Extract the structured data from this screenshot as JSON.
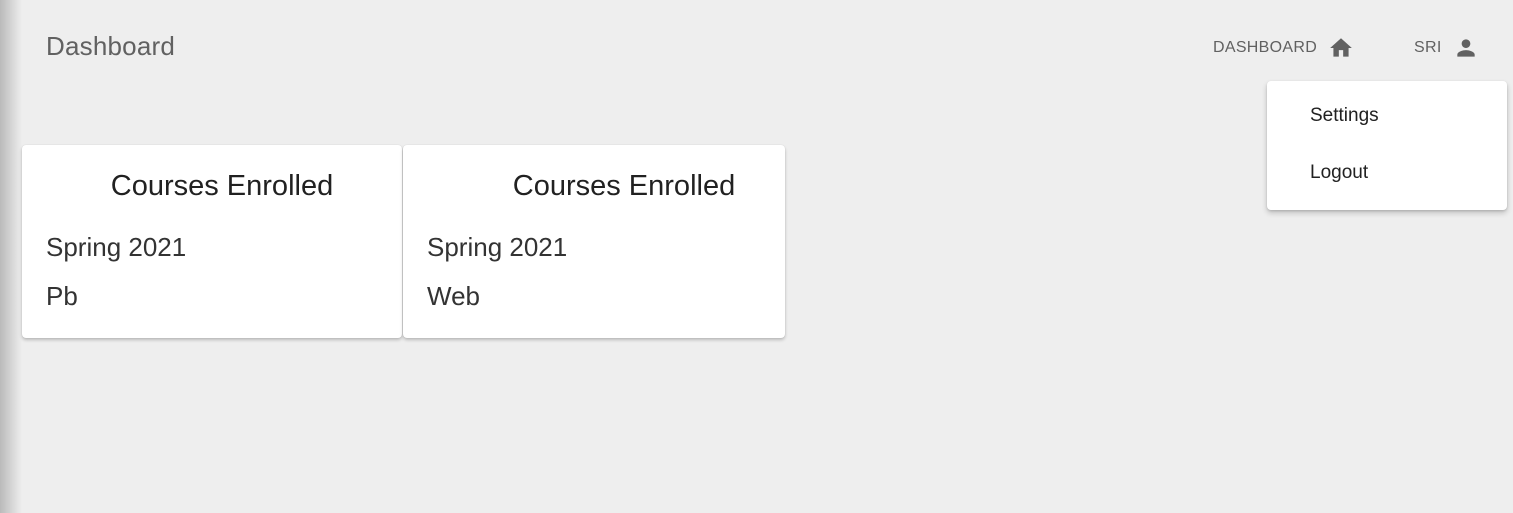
{
  "app": {
    "title": "Dashboard"
  },
  "nav": {
    "dashboard_label": "DASHBOARD",
    "dashboard_icon": "home-icon",
    "user_label": "SRI",
    "user_icon": "person-icon"
  },
  "user_menu": {
    "items": [
      {
        "label": "Settings"
      },
      {
        "label": "Logout"
      }
    ]
  },
  "cards": [
    {
      "title": "Courses Enrolled",
      "term": "Spring 2021",
      "course": "Pb"
    },
    {
      "title": "Courses Enrolled",
      "term": "Spring 2021",
      "course": "Web"
    }
  ],
  "colors": {
    "background": "#eeeeee",
    "card": "#ffffff",
    "text": "#212121",
    "muted": "#616161"
  }
}
